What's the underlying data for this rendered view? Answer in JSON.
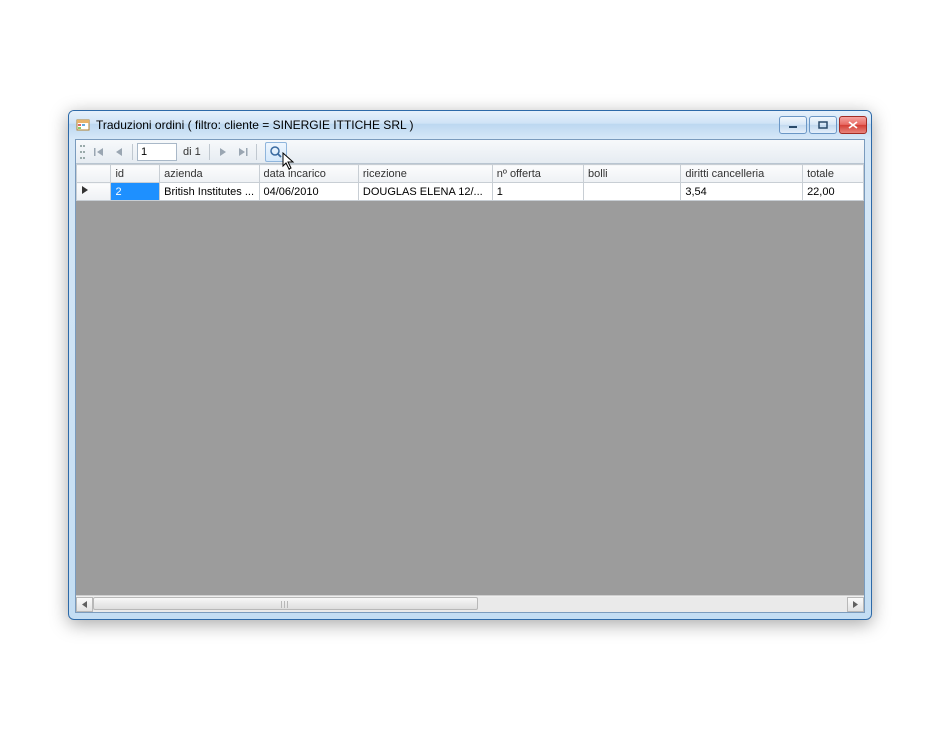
{
  "window": {
    "title": "Traduzioni ordini ( filtro: cliente = SINERGIE ITTICHE SRL   )"
  },
  "navigator": {
    "current": "1",
    "total_label": "di 1"
  },
  "grid": {
    "columns": [
      "id",
      "azienda",
      "data incarico",
      "ricezione",
      "nº offerta",
      "bolli",
      "diritti cancelleria",
      "totale"
    ],
    "rows": [
      {
        "id": "2",
        "azienda": "British Institutes ...",
        "data_incarico": "04/06/2010",
        "ricezione": "DOUGLAS ELENA 12/...",
        "n_offerta": "1",
        "bolli": "",
        "diritti_cancelleria": "3,54",
        "totale": "22,00"
      }
    ]
  }
}
